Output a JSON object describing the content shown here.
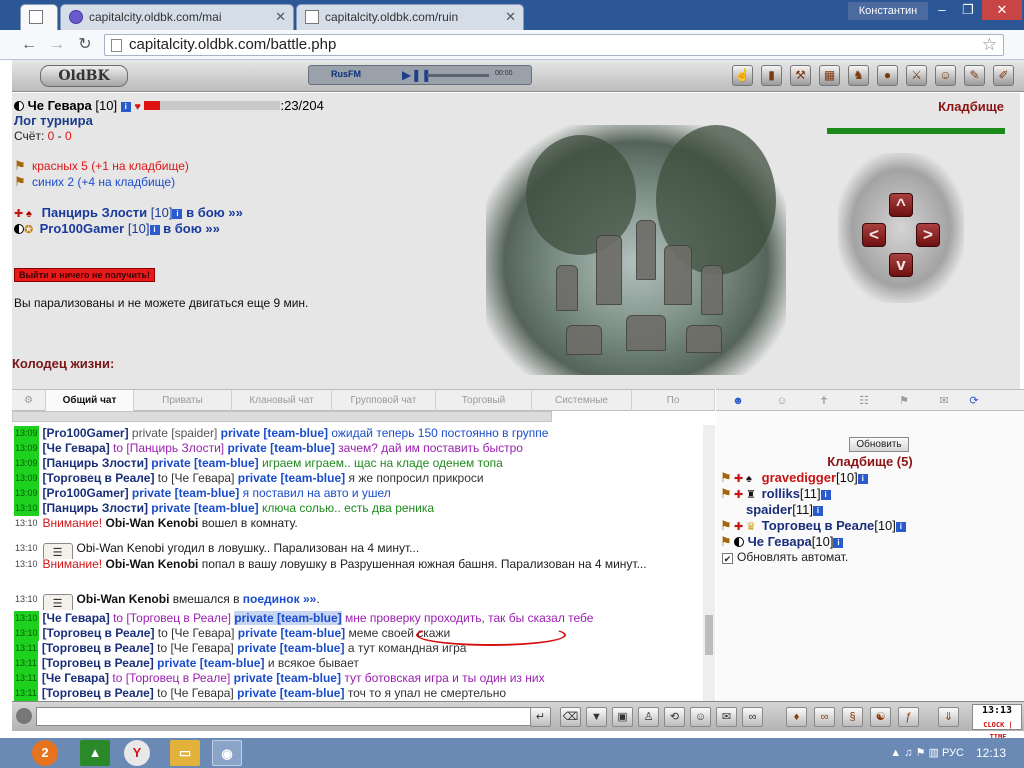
{
  "browser": {
    "tabs": [
      {
        "label": ""
      },
      {
        "label": "capitalcity.oldbk.com/mai"
      },
      {
        "label": "capitalcity.oldbk.com/ruin"
      }
    ],
    "user": "Константин",
    "url": "capitalcity.oldbk.com/battle.php"
  },
  "game": {
    "logo": "OldBK",
    "radio": {
      "label": "RusFM",
      "time": "00:00"
    }
  },
  "battle": {
    "player": {
      "name": "Че Гевара",
      "level": "[10]",
      "hp": ":23/204",
      "hp_fraction": 0.113
    },
    "tournament_log": "Лог турнира",
    "score_label": "Счёт:",
    "score_red": "0",
    "score_sep": "-",
    "score_blue": "0",
    "red_team": "красных 5 (+1 на кладбище)",
    "blue_team": "синих 2 (+4 на кладбище)",
    "fighters": [
      {
        "name": "Панцирь Злости",
        "level": "[10]",
        "status": "в бою »»"
      },
      {
        "name": "Pro100Gamer",
        "level": "[10]",
        "status": "в бою »»"
      }
    ],
    "leave_button": "Выйти и ничего не получить!",
    "paralyzed_text": "Вы парализованы и не можете двигаться еще 9 мин.",
    "well_label": "Колодец жизни:",
    "location": "Кладбище",
    "location_health_fraction": 1.0
  },
  "chat": {
    "tabs": [
      "Общий чат",
      "Приваты",
      "Клановый чат",
      "Групповой чат",
      "Торговый",
      "Системные",
      "По"
    ],
    "lines": [
      {
        "t": "13:09",
        "who": "[Pro100Gamer]",
        "mid": "private [spaider]",
        "priv": "private [team-blue]",
        "msg": "ожидай теперь 150 постоянно в группе",
        "cls": "msg-blue"
      },
      {
        "t": "13:09",
        "who": "[Че Гевара]",
        "mid": "to [Панцирь Злости]",
        "priv": "private [team-blue]",
        "msg": "зачем? дай им поставить быстро",
        "cls": "msg-purple"
      },
      {
        "t": "13:09",
        "who": "[Панцирь Злости]",
        "mid": "",
        "priv": "private [team-blue]",
        "msg": "играем играем.. щас на кладе оденем топа",
        "cls": "msg-green"
      },
      {
        "t": "13:09",
        "who": "[Торговец в Реале]",
        "mid": "to [Че Гевара]",
        "priv": "private [team-blue]",
        "msg": "я же попросил прикроси",
        "cls": "msg-gray"
      },
      {
        "t": "13:09",
        "who": "[Pro100Gamer]",
        "mid": "",
        "priv": "private [team-blue]",
        "msg": "я поставил на авто и ушел",
        "cls": "msg-blue"
      },
      {
        "t": "13:10",
        "who": "[Панцирь Злости]",
        "mid": "",
        "priv": "private [team-blue]",
        "msg": "ключа солью.. есть два реника",
        "cls": "msg-green"
      }
    ],
    "sys1": {
      "t": "13:10",
      "warn": "Внимание!",
      "who": "Obi-Wan Kenobi",
      "msg": "вошел в комнату."
    },
    "sys2": {
      "t": "13:10",
      "who": "Obi-Wan Kenobi",
      "msg": "угодил в ловушку.. Парализован на 4 минут..."
    },
    "sys3": {
      "t": "13:10",
      "warn": "Внимание!",
      "who": "Obi-Wan Kenobi",
      "msg": "попал в вашу ловушку в Разрушенная южная башня. Парализован на 4 минут..."
    },
    "sys4": {
      "t": "13:10",
      "who": "Obi-Wan Kenobi",
      "msg": "вмешался в",
      "link": "поединок »»",
      "end": "."
    },
    "lines2": [
      {
        "t": "13:10",
        "who": "[Че Гевара]",
        "mid": "to [Торговец в Реале]",
        "priv": "private [team-blue]",
        "msg": "мне проверку проходить, так бы сказал тебе",
        "cls": "msg-purple"
      },
      {
        "t": "13:10",
        "who": "[Торговец в Реале]",
        "mid": "to [Че Гевара]",
        "priv": "private [team-blue]",
        "msg": "меме своей скажи",
        "cls": "msg-gray"
      },
      {
        "t": "13:11",
        "who": "[Торговец в Реале]",
        "mid": "to [Че Гевара]",
        "priv": "private [team-blue]",
        "msg": "а тут командная игра",
        "cls": "msg-gray"
      },
      {
        "t": "13:11",
        "who": "[Торговец в Реале]",
        "mid": "",
        "priv": "private [team-blue]",
        "msg": "и всякое бывает",
        "cls": "msg-gray"
      },
      {
        "t": "13:11",
        "who": "[Че Гевара]",
        "mid": "to [Торговец в Реале]",
        "priv": "private [team-blue]",
        "msg": "тут ботовская игра и ты один из них",
        "cls": "msg-purple"
      },
      {
        "t": "13:11",
        "who": "[Торговец в Реале]",
        "mid": "to [Че Гевара]",
        "priv": "private [team-blue]",
        "msg": "точ то я упал не смертельно",
        "cls": "msg-gray"
      }
    ]
  },
  "room": {
    "refresh": "Обновить",
    "title": "Кладбище (5)",
    "players": [
      {
        "name": "gravedigger",
        "level": "[10]",
        "red": true
      },
      {
        "name": "rolliks",
        "level": "[11]",
        "red": false
      },
      {
        "name": "spaider",
        "level": "[11]",
        "red": false
      },
      {
        "name": "Торговец в Реале",
        "level": "[10]",
        "red": false
      },
      {
        "name": "Че Гевара",
        "level": "[10]",
        "red": false
      }
    ],
    "auto_refresh": "Обновлять автомат."
  },
  "taskbar": {
    "lang": "РУС",
    "time": "12:13",
    "badge": "2"
  },
  "clock": {
    "time": "13:13",
    "label": "CLOCK | TIME"
  }
}
